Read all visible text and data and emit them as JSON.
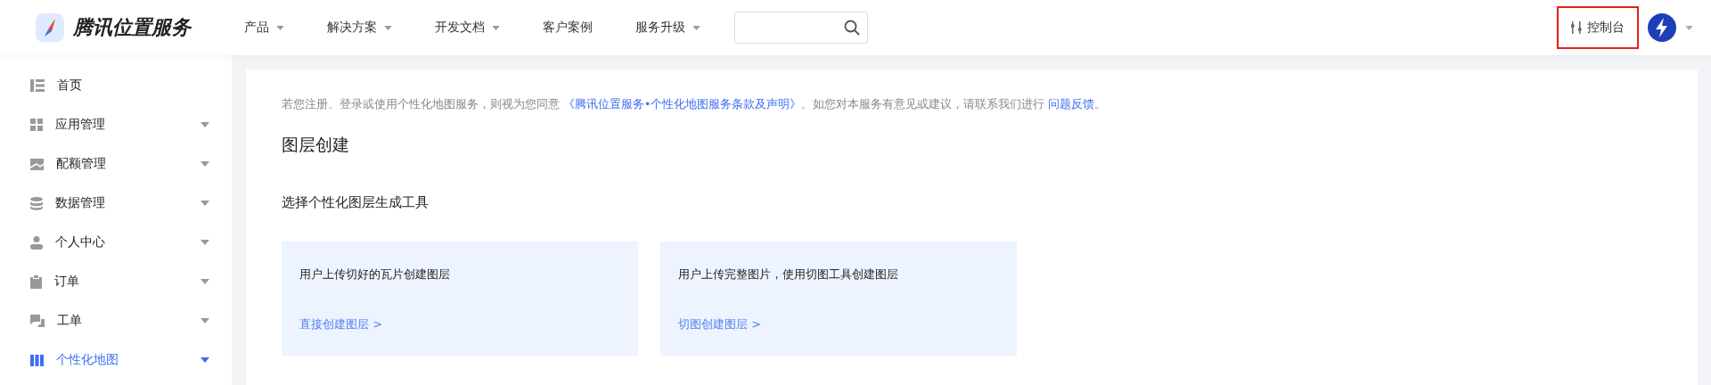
{
  "header": {
    "brand": "腾讯位置服务",
    "nav": [
      {
        "label": "产品",
        "dropdown": true
      },
      {
        "label": "解决方案",
        "dropdown": true
      },
      {
        "label": "开发文档",
        "dropdown": true
      },
      {
        "label": "客户案例",
        "dropdown": false
      },
      {
        "label": "服务升级",
        "dropdown": true
      }
    ],
    "console": "控制台"
  },
  "sidebar": {
    "items": [
      {
        "label": "首页",
        "expandable": false,
        "selected": false
      },
      {
        "label": "应用管理",
        "expandable": true,
        "selected": false
      },
      {
        "label": "配额管理",
        "expandable": true,
        "selected": false
      },
      {
        "label": "数据管理",
        "expandable": true,
        "selected": false
      },
      {
        "label": "个人中心",
        "expandable": true,
        "selected": false
      },
      {
        "label": "订单",
        "expandable": true,
        "selected": false
      },
      {
        "label": "工单",
        "expandable": true,
        "selected": false
      },
      {
        "label": "个性化地图",
        "expandable": true,
        "selected": true
      }
    ]
  },
  "content": {
    "notice": "若您注册、登录或使用个性化地图服务，则视为您同意 ",
    "notice_link": "《腾讯位置服务•个性化地图服务条款及声明》",
    "notice_middle": "。如您对本服务有意见或建议，请联系我们进行 ",
    "feedback_link": "问题反馈",
    "notice_end": "。",
    "title": "图层创建",
    "subtitle": "选择个性化图层生成工具",
    "cards": [
      {
        "description": "用户上传切好的瓦片创建图层",
        "link": "直接创建图层 >"
      },
      {
        "description": "用户上传完整图片，使用切图工具创建图层",
        "link": "切图创建图层 >"
      }
    ]
  }
}
